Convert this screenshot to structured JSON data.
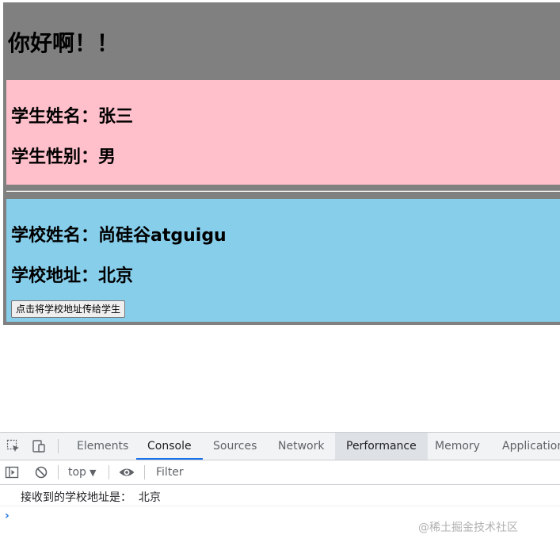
{
  "app": {
    "title": "你好啊！！",
    "student": {
      "name_line": "学生姓名：张三",
      "gender_line": "学生性别：男"
    },
    "school": {
      "name_line": "学校姓名：尚硅谷atguigu",
      "address_line": "学校地址：北京",
      "button_label": "点击将学校地址传给学生"
    },
    "colors": {
      "app_bg": "#808080",
      "student_bg": "#ffc0cb",
      "school_bg": "#87ceeb"
    }
  },
  "devtools": {
    "tabs": [
      "Elements",
      "Console",
      "Sources",
      "Network",
      "Performance",
      "Memory",
      "Application"
    ],
    "active_tab": "Console",
    "toolbar": {
      "context": "top",
      "filter_placeholder": "Filter"
    },
    "console_log": "接收到的学校地址是：  北京",
    "icons": [
      "inspect-element-icon",
      "device-toggle-icon",
      "sidebar-toggle-icon",
      "clear-console-icon",
      "eye-icon",
      "prompt-chevron-icon"
    ],
    "accent": "#1a73e8"
  },
  "watermark": "@稀土掘金技术社区"
}
